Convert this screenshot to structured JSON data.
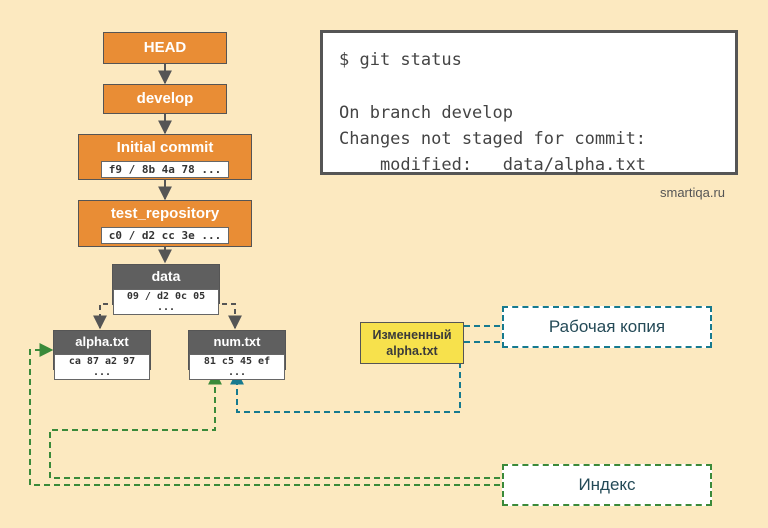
{
  "colors": {
    "bg": "#fce9c0",
    "orange": "#e98d35",
    "grey": "#5f5f5f",
    "yellow": "#f7e14c",
    "working_dash": "#167a8f",
    "index_dash": "#3a8a3a"
  },
  "tree": {
    "head": {
      "label": "HEAD"
    },
    "branch": {
      "label": "develop"
    },
    "commit": {
      "label": "Initial commit",
      "hash": "f9 / 8b 4a 78 ..."
    },
    "root_tree": {
      "label": "test_repository",
      "hash": "c0 / d2 cc 3e ..."
    },
    "data_tree": {
      "label": "data",
      "hash": "09 / d2 0c 05 ..."
    },
    "alpha_blob": {
      "label": "alpha.txt",
      "hash": "ca 87 a2 97 ..."
    },
    "num_blob": {
      "label": "num.txt",
      "hash": "81 c5 45 ef ..."
    },
    "modified": {
      "line1": "Измененный",
      "line2": "alpha.txt"
    }
  },
  "terminal": {
    "line1": "$ git status",
    "line2": "On branch develop",
    "line3": "Changes not staged for commit:",
    "line4": "    modified:   data/alpha.txt"
  },
  "labels": {
    "working_copy": "Рабочая копия",
    "index": "Индекс"
  },
  "attribution": "smartiqa.ru"
}
